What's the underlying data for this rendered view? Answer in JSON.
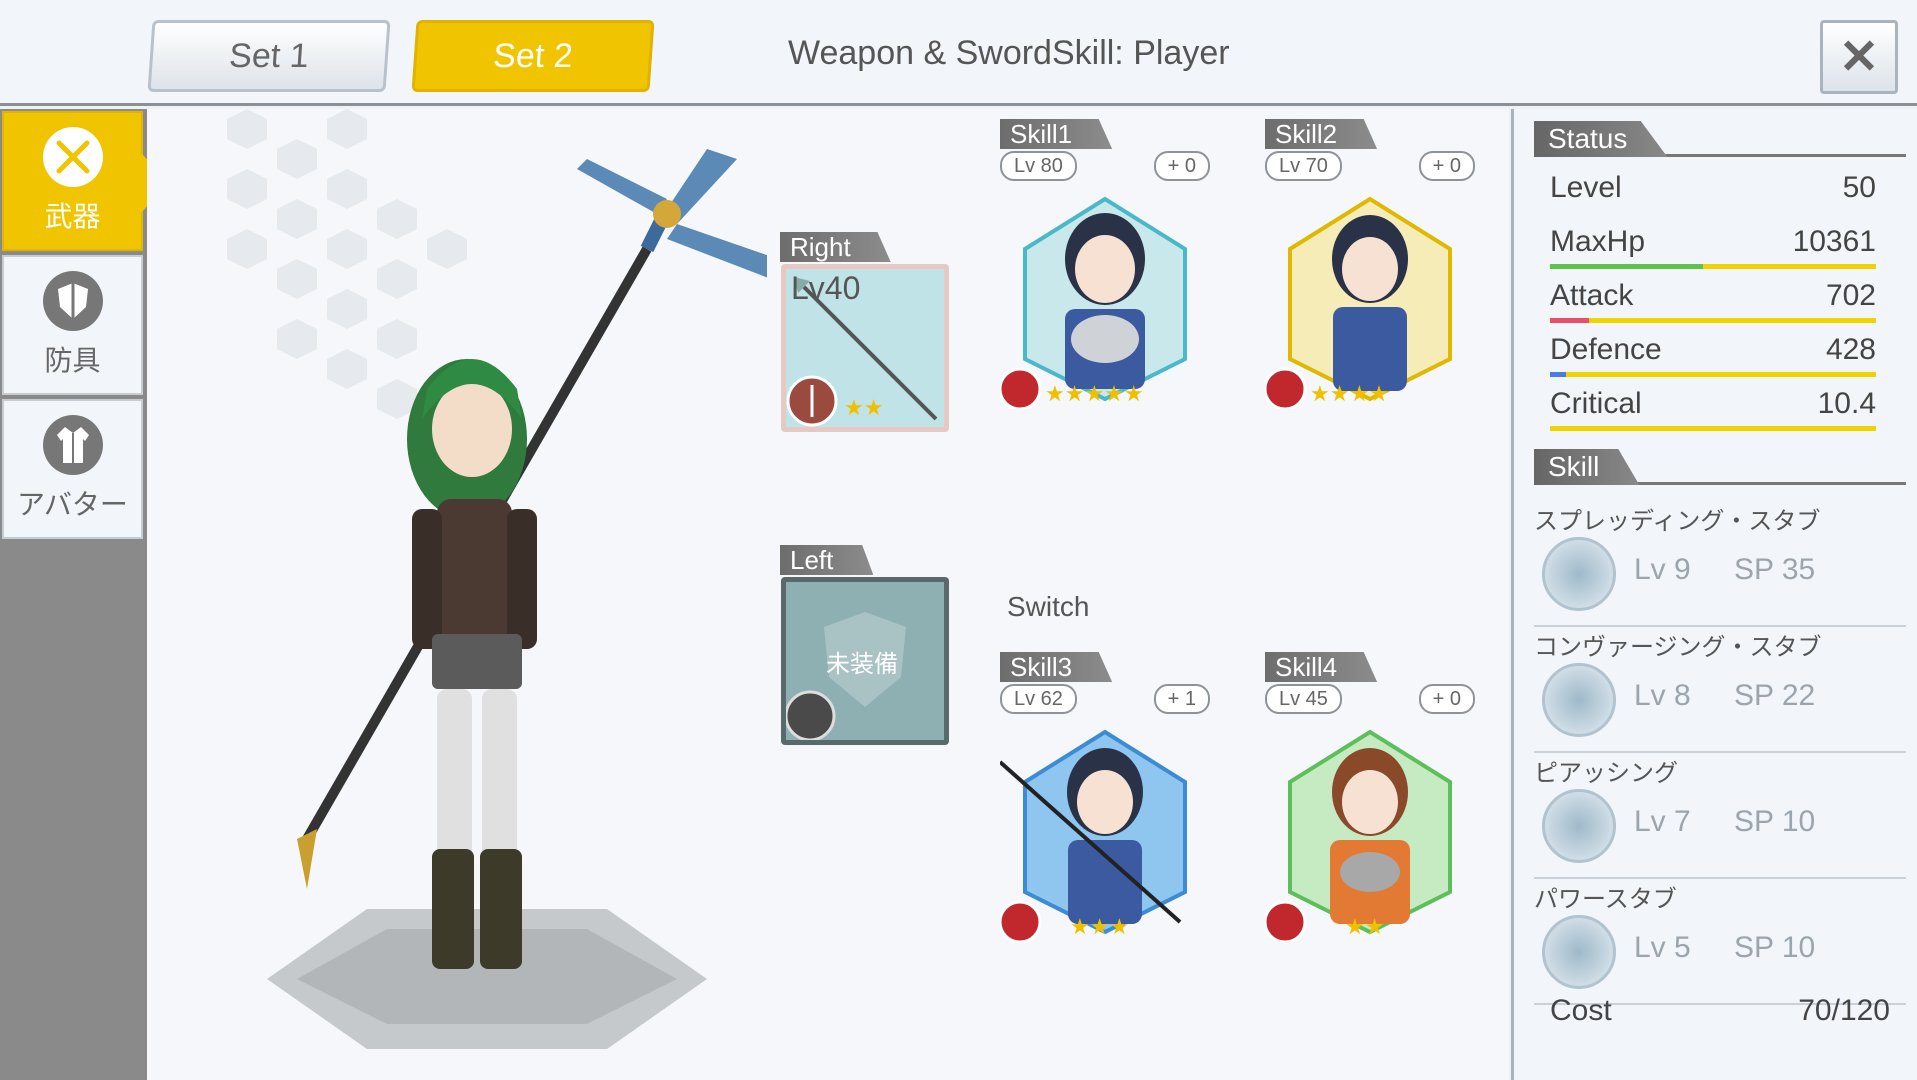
{
  "header": {
    "tabs": [
      {
        "label": "Set 1",
        "active": false
      },
      {
        "label": "Set 2",
        "active": true
      }
    ],
    "title": "Weapon & SwordSkill: Player",
    "close_label": "✕"
  },
  "sidebar": {
    "items": [
      {
        "label": "武器",
        "icon": "swords-icon",
        "active": true
      },
      {
        "label": "防具",
        "icon": "shield-icon",
        "active": false
      },
      {
        "label": "アバター",
        "icon": "coat-icon",
        "active": false
      }
    ]
  },
  "equipment": {
    "right": {
      "label": "Right",
      "level": "Lv40",
      "stars": 2
    },
    "left": {
      "label": "Left",
      "empty_text": "未装備"
    }
  },
  "skills": [
    {
      "label": "Skill1",
      "level": "Lv 80",
      "plus": "+ 0",
      "stars": 5,
      "note": "Switch"
    },
    {
      "label": "Skill2",
      "level": "Lv 70",
      "plus": "+ 0",
      "stars": 4
    },
    {
      "label": "Skill3",
      "level": "Lv 62",
      "plus": "+ 1",
      "stars": 3
    },
    {
      "label": "Skill4",
      "level": "Lv 45",
      "plus": "+ 0",
      "stars": 2
    }
  ],
  "status": {
    "heading": "Status",
    "rows": [
      {
        "name": "Level",
        "value": "50"
      },
      {
        "name": "MaxHp",
        "value": "10361",
        "fill_pct": 47,
        "fill_color": "#5fc24a"
      },
      {
        "name": "Attack",
        "value": "702",
        "fill_pct": 12,
        "fill_color": "#e8506a"
      },
      {
        "name": "Defence",
        "value": "428",
        "fill_pct": 5,
        "fill_color": "#4a7be8"
      },
      {
        "name": "Critical",
        "value": "10.4",
        "fill_pct": 0,
        "fill_color": "#f0d400"
      }
    ]
  },
  "skill_list": {
    "heading": "Skill",
    "items": [
      {
        "name": "スプレッディング・スタブ",
        "lv": "Lv 9",
        "sp": "SP 35"
      },
      {
        "name": "コンヴァージング・スタブ",
        "lv": "Lv 8",
        "sp": "SP 22"
      },
      {
        "name": "ピアッシング",
        "lv": "Lv 7",
        "sp": "SP 10"
      },
      {
        "name": "パワースタブ",
        "lv": "Lv 5",
        "sp": "SP 10"
      }
    ]
  },
  "cost": {
    "label": "Cost",
    "value": "70/120"
  },
  "colors": {
    "accent": "#f1c400",
    "panel": "#f2f5f9",
    "sidebar": "#8a8a8a"
  }
}
